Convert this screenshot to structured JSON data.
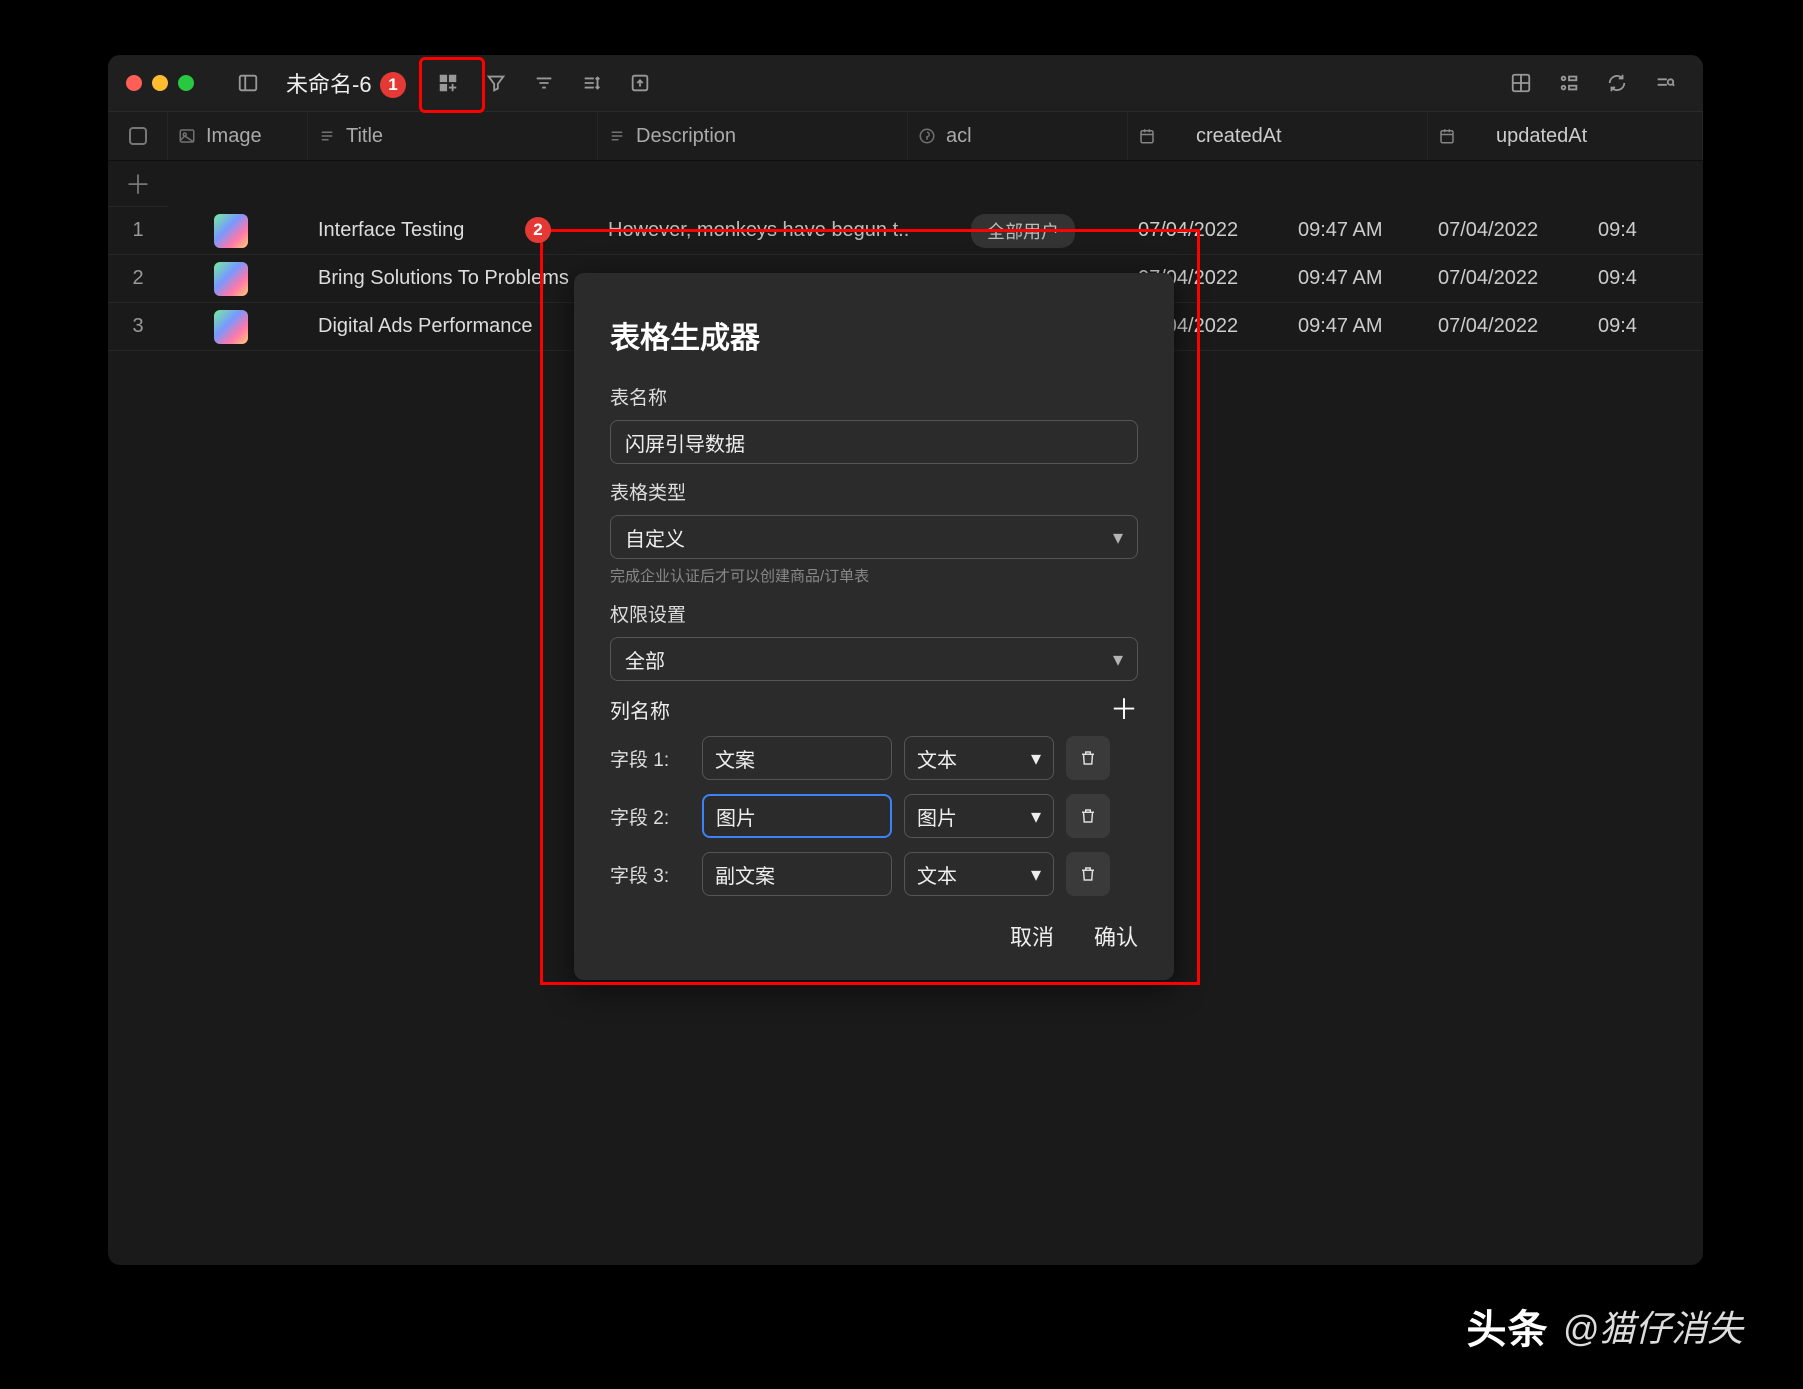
{
  "window": {
    "title": "未命名-6"
  },
  "annotations": {
    "badge1": "1",
    "badge2": "2"
  },
  "columns": {
    "image": "Image",
    "title": "Title",
    "description": "Description",
    "acl": "acl",
    "createdAt": "createdAt",
    "updatedAt": "updatedAt"
  },
  "rows": [
    {
      "idx": "1",
      "title": "Interface Testing",
      "desc": "However, monkeys have begun t...",
      "acl": "全部用户",
      "createdDate": "07/04/2022",
      "createdTime": "09:47 AM",
      "updatedDate": "07/04/2022",
      "updatedTime": "09:4"
    },
    {
      "idx": "2",
      "title": "Bring Solutions To Problems",
      "desc": "",
      "acl": "",
      "createdDate": "07/04/2022",
      "createdTime": "09:47 AM",
      "updatedDate": "07/04/2022",
      "updatedTime": "09:4"
    },
    {
      "idx": "3",
      "title": "Digital Ads Performance",
      "desc": "",
      "acl": "",
      "createdDate": "07/04/2022",
      "createdTime": "09:47 AM",
      "updatedDate": "07/04/2022",
      "updatedTime": "09:4"
    }
  ],
  "modal": {
    "heading": "表格生成器",
    "tableNameLabel": "表名称",
    "tableNameValue": "闪屏引导数据",
    "tableTypeLabel": "表格类型",
    "tableTypeValue": "自定义",
    "tableTypeHint": "完成企业认证后才可以创建商品/订单表",
    "permLabel": "权限设置",
    "permValue": "全部",
    "colLabel": "列名称",
    "fields": [
      {
        "label": "字段 1:",
        "name": "文案",
        "type": "文本",
        "focus": false
      },
      {
        "label": "字段 2:",
        "name": "图片",
        "type": "图片",
        "focus": true
      },
      {
        "label": "字段 3:",
        "name": "副文案",
        "type": "文本",
        "focus": false
      }
    ],
    "cancel": "取消",
    "confirm": "确认"
  },
  "watermark": {
    "brand": "头条",
    "at": "@猫仔消失"
  }
}
